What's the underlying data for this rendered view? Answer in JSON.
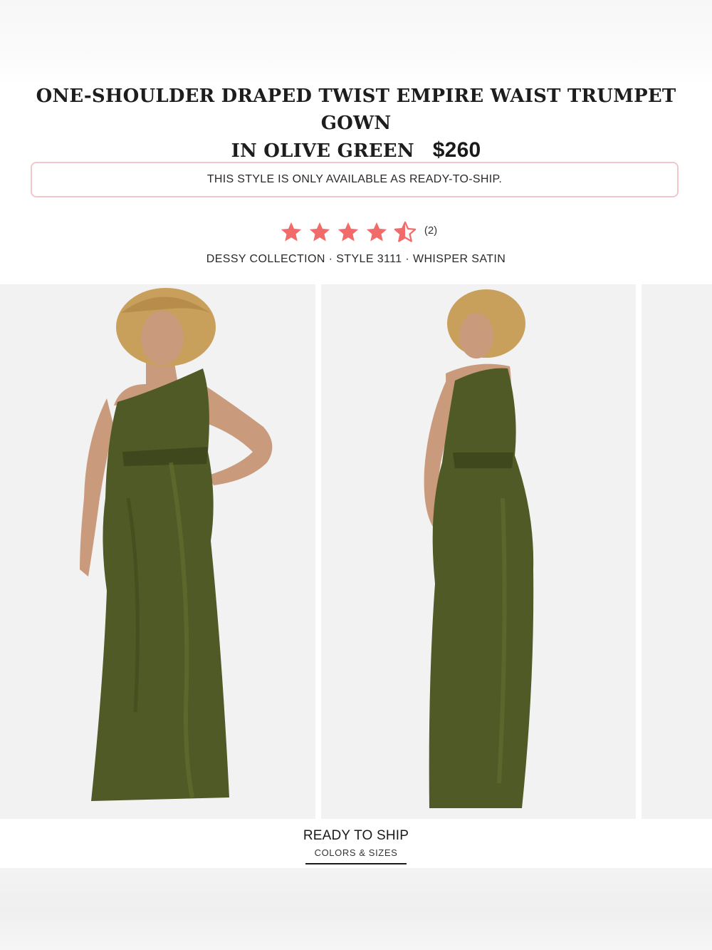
{
  "product": {
    "title_line1": "ONE-SHOULDER DRAPED TWIST EMPIRE WAIST TRUMPET GOWN",
    "title_line2": "IN OLIVE GREEN",
    "price": "$260"
  },
  "notice": "THIS STYLE IS ONLY AVAILABLE AS READY-TO-SHIP.",
  "rating": {
    "stars": 4.5,
    "max": 5,
    "count_label": "(2)",
    "star_color": "#f26b6b"
  },
  "meta": "DESSY COLLECTION · STYLE 3111 · WHISPER SATIN",
  "gallery": {
    "images": [
      {
        "name": "front view",
        "dress_color": "#4f5a26"
      },
      {
        "name": "back view",
        "dress_color": "#4f5a26"
      },
      {
        "name": "next image"
      }
    ]
  },
  "tab": {
    "title": "READY TO SHIP",
    "subtitle": "COLORS & SIZES"
  }
}
